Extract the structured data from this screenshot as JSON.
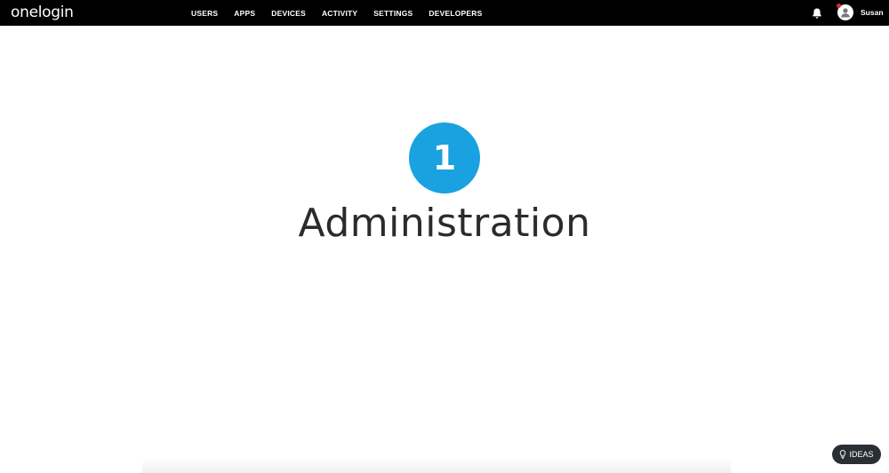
{
  "header": {
    "logo": "onelogin",
    "nav": [
      "USERS",
      "APPS",
      "DEVICES",
      "ACTIVITY",
      "SETTINGS",
      "DEVELOPERS"
    ],
    "notification_icon": "bell-icon",
    "user": {
      "name": "Susan",
      "has_notification_dot": true
    }
  },
  "main": {
    "step_number": "1",
    "title": "Administration"
  },
  "ideas_button": {
    "label": "IDEAS",
    "icon": "lightbulb-icon"
  },
  "colors": {
    "topbar": "#000000",
    "accent": "#1aa1df",
    "title_text": "#2b2b2b",
    "ideas_bg": "#2a2f36",
    "notification_dot": "#e0252b"
  }
}
